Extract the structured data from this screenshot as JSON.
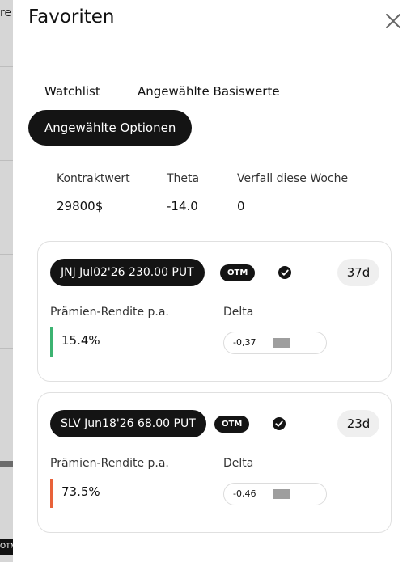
{
  "backdrop": {
    "edge_text": "re",
    "tag": "OTM"
  },
  "header": {
    "title": "Favoriten"
  },
  "tabs": [
    {
      "label": "Watchlist"
    },
    {
      "label": "Angewählte Basiswerte"
    },
    {
      "label": "Angewählte Optionen",
      "active": true
    }
  ],
  "summary": {
    "items": [
      {
        "label": "Kontraktwert",
        "value": "29800$"
      },
      {
        "label": "Theta",
        "value": "-14.0"
      },
      {
        "label": "Verfall diese Woche",
        "value": "0"
      }
    ]
  },
  "cards": [
    {
      "option": "JNJ Jul02'26 230.00 PUT",
      "badge": "OTM",
      "days": "37d",
      "yield_label": "Prämien-Rendite p.a.",
      "yield": "15.4%",
      "yield_color": "#3cb371",
      "delta_label": "Delta",
      "delta": "-0,37"
    },
    {
      "option": "SLV Jun18'26 68.00 PUT",
      "badge": "OTM",
      "days": "23d",
      "yield_label": "Prämien-Rendite p.a.",
      "yield": "73.5%",
      "yield_color": "#e8623a",
      "delta_label": "Delta",
      "delta": "-0,46"
    }
  ],
  "colors": {
    "accent": "#141414",
    "surface": "#ffffff",
    "muted": "#efefef"
  }
}
